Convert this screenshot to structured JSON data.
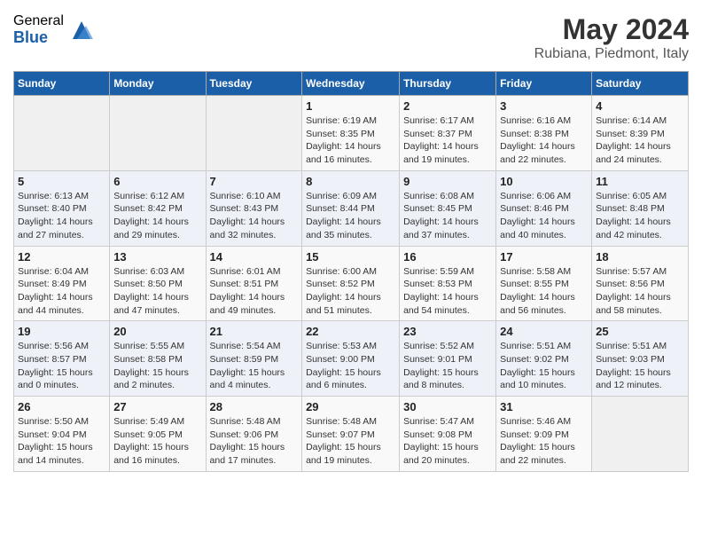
{
  "logo": {
    "general": "General",
    "blue": "Blue"
  },
  "header": {
    "title": "May 2024",
    "subtitle": "Rubiana, Piedmont, Italy"
  },
  "weekdays": [
    "Sunday",
    "Monday",
    "Tuesday",
    "Wednesday",
    "Thursday",
    "Friday",
    "Saturday"
  ],
  "weeks": [
    [
      {
        "day": "",
        "sunrise": "",
        "sunset": "",
        "daylight": ""
      },
      {
        "day": "",
        "sunrise": "",
        "sunset": "",
        "daylight": ""
      },
      {
        "day": "",
        "sunrise": "",
        "sunset": "",
        "daylight": ""
      },
      {
        "day": "1",
        "sunrise": "Sunrise: 6:19 AM",
        "sunset": "Sunset: 8:35 PM",
        "daylight": "Daylight: 14 hours and 16 minutes."
      },
      {
        "day": "2",
        "sunrise": "Sunrise: 6:17 AM",
        "sunset": "Sunset: 8:37 PM",
        "daylight": "Daylight: 14 hours and 19 minutes."
      },
      {
        "day": "3",
        "sunrise": "Sunrise: 6:16 AM",
        "sunset": "Sunset: 8:38 PM",
        "daylight": "Daylight: 14 hours and 22 minutes."
      },
      {
        "day": "4",
        "sunrise": "Sunrise: 6:14 AM",
        "sunset": "Sunset: 8:39 PM",
        "daylight": "Daylight: 14 hours and 24 minutes."
      }
    ],
    [
      {
        "day": "5",
        "sunrise": "Sunrise: 6:13 AM",
        "sunset": "Sunset: 8:40 PM",
        "daylight": "Daylight: 14 hours and 27 minutes."
      },
      {
        "day": "6",
        "sunrise": "Sunrise: 6:12 AM",
        "sunset": "Sunset: 8:42 PM",
        "daylight": "Daylight: 14 hours and 29 minutes."
      },
      {
        "day": "7",
        "sunrise": "Sunrise: 6:10 AM",
        "sunset": "Sunset: 8:43 PM",
        "daylight": "Daylight: 14 hours and 32 minutes."
      },
      {
        "day": "8",
        "sunrise": "Sunrise: 6:09 AM",
        "sunset": "Sunset: 8:44 PM",
        "daylight": "Daylight: 14 hours and 35 minutes."
      },
      {
        "day": "9",
        "sunrise": "Sunrise: 6:08 AM",
        "sunset": "Sunset: 8:45 PM",
        "daylight": "Daylight: 14 hours and 37 minutes."
      },
      {
        "day": "10",
        "sunrise": "Sunrise: 6:06 AM",
        "sunset": "Sunset: 8:46 PM",
        "daylight": "Daylight: 14 hours and 40 minutes."
      },
      {
        "day": "11",
        "sunrise": "Sunrise: 6:05 AM",
        "sunset": "Sunset: 8:48 PM",
        "daylight": "Daylight: 14 hours and 42 minutes."
      }
    ],
    [
      {
        "day": "12",
        "sunrise": "Sunrise: 6:04 AM",
        "sunset": "Sunset: 8:49 PM",
        "daylight": "Daylight: 14 hours and 44 minutes."
      },
      {
        "day": "13",
        "sunrise": "Sunrise: 6:03 AM",
        "sunset": "Sunset: 8:50 PM",
        "daylight": "Daylight: 14 hours and 47 minutes."
      },
      {
        "day": "14",
        "sunrise": "Sunrise: 6:01 AM",
        "sunset": "Sunset: 8:51 PM",
        "daylight": "Daylight: 14 hours and 49 minutes."
      },
      {
        "day": "15",
        "sunrise": "Sunrise: 6:00 AM",
        "sunset": "Sunset: 8:52 PM",
        "daylight": "Daylight: 14 hours and 51 minutes."
      },
      {
        "day": "16",
        "sunrise": "Sunrise: 5:59 AM",
        "sunset": "Sunset: 8:53 PM",
        "daylight": "Daylight: 14 hours and 54 minutes."
      },
      {
        "day": "17",
        "sunrise": "Sunrise: 5:58 AM",
        "sunset": "Sunset: 8:55 PM",
        "daylight": "Daylight: 14 hours and 56 minutes."
      },
      {
        "day": "18",
        "sunrise": "Sunrise: 5:57 AM",
        "sunset": "Sunset: 8:56 PM",
        "daylight": "Daylight: 14 hours and 58 minutes."
      }
    ],
    [
      {
        "day": "19",
        "sunrise": "Sunrise: 5:56 AM",
        "sunset": "Sunset: 8:57 PM",
        "daylight": "Daylight: 15 hours and 0 minutes."
      },
      {
        "day": "20",
        "sunrise": "Sunrise: 5:55 AM",
        "sunset": "Sunset: 8:58 PM",
        "daylight": "Daylight: 15 hours and 2 minutes."
      },
      {
        "day": "21",
        "sunrise": "Sunrise: 5:54 AM",
        "sunset": "Sunset: 8:59 PM",
        "daylight": "Daylight: 15 hours and 4 minutes."
      },
      {
        "day": "22",
        "sunrise": "Sunrise: 5:53 AM",
        "sunset": "Sunset: 9:00 PM",
        "daylight": "Daylight: 15 hours and 6 minutes."
      },
      {
        "day": "23",
        "sunrise": "Sunrise: 5:52 AM",
        "sunset": "Sunset: 9:01 PM",
        "daylight": "Daylight: 15 hours and 8 minutes."
      },
      {
        "day": "24",
        "sunrise": "Sunrise: 5:51 AM",
        "sunset": "Sunset: 9:02 PM",
        "daylight": "Daylight: 15 hours and 10 minutes."
      },
      {
        "day": "25",
        "sunrise": "Sunrise: 5:51 AM",
        "sunset": "Sunset: 9:03 PM",
        "daylight": "Daylight: 15 hours and 12 minutes."
      }
    ],
    [
      {
        "day": "26",
        "sunrise": "Sunrise: 5:50 AM",
        "sunset": "Sunset: 9:04 PM",
        "daylight": "Daylight: 15 hours and 14 minutes."
      },
      {
        "day": "27",
        "sunrise": "Sunrise: 5:49 AM",
        "sunset": "Sunset: 9:05 PM",
        "daylight": "Daylight: 15 hours and 16 minutes."
      },
      {
        "day": "28",
        "sunrise": "Sunrise: 5:48 AM",
        "sunset": "Sunset: 9:06 PM",
        "daylight": "Daylight: 15 hours and 17 minutes."
      },
      {
        "day": "29",
        "sunrise": "Sunrise: 5:48 AM",
        "sunset": "Sunset: 9:07 PM",
        "daylight": "Daylight: 15 hours and 19 minutes."
      },
      {
        "day": "30",
        "sunrise": "Sunrise: 5:47 AM",
        "sunset": "Sunset: 9:08 PM",
        "daylight": "Daylight: 15 hours and 20 minutes."
      },
      {
        "day": "31",
        "sunrise": "Sunrise: 5:46 AM",
        "sunset": "Sunset: 9:09 PM",
        "daylight": "Daylight: 15 hours and 22 minutes."
      },
      {
        "day": "",
        "sunrise": "",
        "sunset": "",
        "daylight": ""
      }
    ]
  ]
}
